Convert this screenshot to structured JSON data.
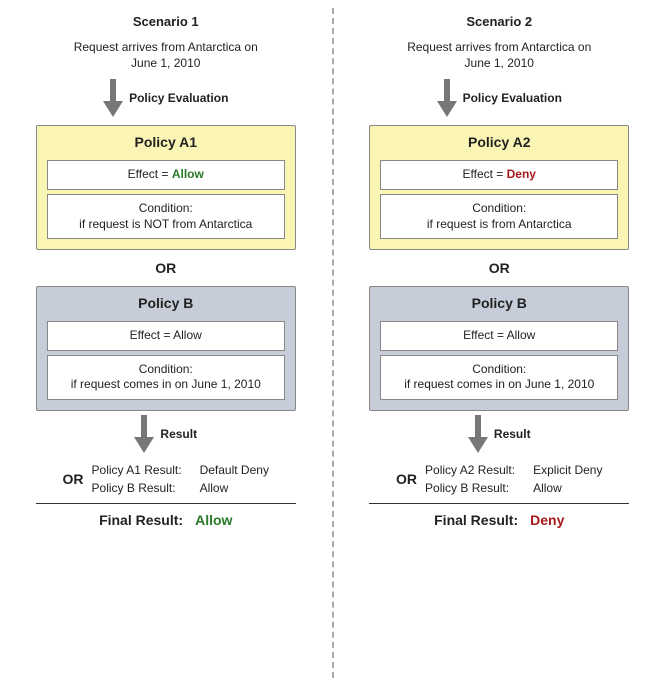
{
  "chart_data": {
    "type": "table",
    "title": "Policy evaluation — Allow vs Deny scenarios",
    "scenarios": [
      {
        "name": "Scenario 1",
        "request": "Request arrives from Antarctica on June 1, 2010",
        "policies": [
          {
            "name": "Policy A1",
            "effect": "Allow",
            "condition": "if request is NOT from Antarctica",
            "result": "Default Deny"
          },
          {
            "name": "Policy B",
            "effect": "Allow",
            "condition": "if request comes in on June 1, 2010",
            "result": "Allow"
          }
        ],
        "combiner": "OR",
        "final_result": "Allow"
      },
      {
        "name": "Scenario 2",
        "request": "Request arrives from Antarctica on June 1, 2010",
        "policies": [
          {
            "name": "Policy A2",
            "effect": "Deny",
            "condition": "if request is from Antarctica",
            "result": "Explicit Deny"
          },
          {
            "name": "Policy B",
            "effect": "Allow",
            "condition": "if request comes in on June 1, 2010",
            "result": "Allow"
          }
        ],
        "combiner": "OR",
        "final_result": "Deny"
      }
    ]
  },
  "labels": {
    "policy_evaluation": "Policy Evaluation",
    "result": "Result",
    "or": "OR",
    "effect_prefix": "Effect = ",
    "condition_prefix": "Condition:",
    "final_result": "Final Result:",
    "result_suffix": " Result:"
  },
  "left": {
    "title": "Scenario 1",
    "request_l1": "Request arrives from Antarctica on",
    "request_l2": "June 1, 2010",
    "policyA_name": "Policy A1",
    "policyA_effect_value": "Allow",
    "policyA_condition": "if request is NOT from Antarctica",
    "policyB_name": "Policy B",
    "policyB_effect_value": "Allow",
    "policyB_condition": "if request comes in on June 1, 2010",
    "resA_label": "Policy A1 Result:",
    "resA_value": "Default Deny",
    "resB_label": "Policy B Result:",
    "resB_value": "Allow",
    "final_value": "Allow"
  },
  "right": {
    "title": "Scenario 2",
    "request_l1": "Request arrives from Antarctica on",
    "request_l2": "June 1, 2010",
    "policyA_name": "Policy A2",
    "policyA_effect_value": "Deny",
    "policyA_condition": "if request is from Antarctica",
    "policyB_name": "Policy B",
    "policyB_effect_value": "Allow",
    "policyB_condition": "if request comes in on June 1, 2010",
    "resA_label": "Policy A2 Result:",
    "resA_value": "Explicit Deny",
    "resB_label": "Policy B Result:",
    "resB_value": "Allow",
    "final_value": "Deny"
  }
}
